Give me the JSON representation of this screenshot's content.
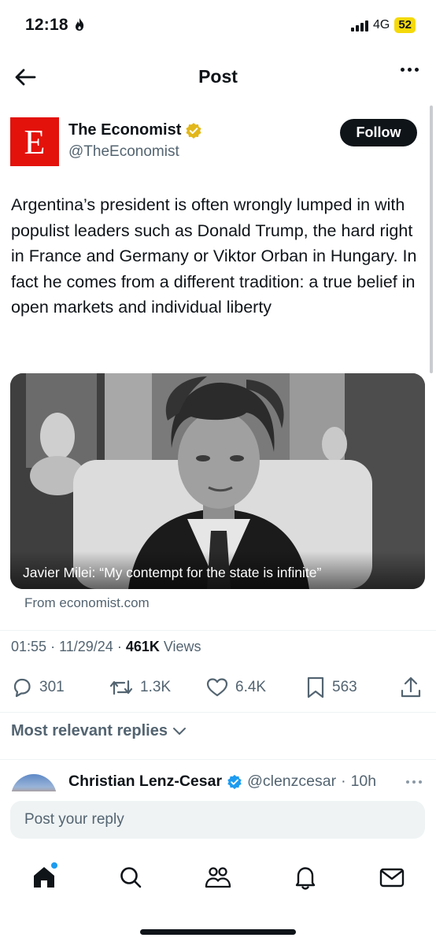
{
  "status": {
    "time": "12:18",
    "network": "4G",
    "battery": "52"
  },
  "header": {
    "title": "Post"
  },
  "author": {
    "avatar_letter": "E",
    "name": "The Economist",
    "handle": "@TheEconomist",
    "follow_label": "Follow",
    "avatar_color": "#e3120b"
  },
  "post": {
    "text": "Argentina’s president is often wrongly lumped in with populist leaders such as Donald Trump, the hard right in France and Germany or Viktor Orban in Hungary. In fact he comes from a different tradition: a true belief in open markets and individual liberty",
    "media_caption": "Javier Milei: “My contempt for the state is infinite”",
    "source": "From economist.com",
    "time": "01:55",
    "date": "11/29/24",
    "views_count": "461K",
    "views_label": "Views"
  },
  "actions": {
    "replies": "301",
    "reposts": "1.3K",
    "likes": "6.4K",
    "bookmarks": "563"
  },
  "replies_filter": {
    "label": "Most relevant replies"
  },
  "reply_preview": {
    "name": "Christian Lenz-Cesar",
    "handle": "@clenzcesar",
    "age": "10h"
  },
  "compose": {
    "placeholder": "Post your reply"
  },
  "tabs": [
    "home-icon",
    "search-icon",
    "communities-icon",
    "notifications-icon",
    "messages-icon"
  ],
  "colors": {
    "accent": "#1d9bf0",
    "verified_gold": "#e2b719",
    "verified_blue": "#1d9bf0",
    "battery": "#f5d90a"
  }
}
